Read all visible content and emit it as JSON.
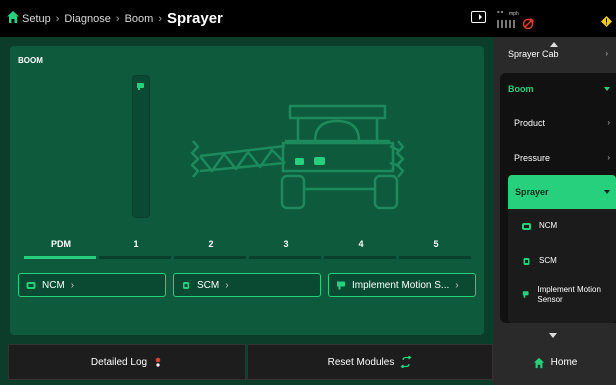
{
  "header": {
    "breadcrumbs": [
      "Setup",
      "Diagnose",
      "Boom"
    ],
    "title": "Sprayer",
    "speed": "--",
    "speed_unit": "mph"
  },
  "main": {
    "section_title": "BOOM",
    "tabs": [
      {
        "label": "PDM",
        "active": true
      },
      {
        "label": "1",
        "active": false
      },
      {
        "label": "2",
        "active": false
      },
      {
        "label": "3",
        "active": false
      },
      {
        "label": "4",
        "active": false
      },
      {
        "label": "5",
        "active": false
      }
    ],
    "modules": [
      {
        "label": "NCM",
        "icon": "ncm-module-icon"
      },
      {
        "label": "SCM",
        "icon": "scm-module-icon"
      },
      {
        "label": "Implement Motion S...",
        "icon": "motion-sensor-icon"
      }
    ]
  },
  "footer": {
    "detailed_log": "Detailed Log",
    "reset_modules": "Reset Modules"
  },
  "sidebar": {
    "cab": "Sprayer Cab",
    "boom": "Boom",
    "product": "Product",
    "pressure": "Pressure",
    "sprayer": "Sprayer",
    "leaves": [
      {
        "label": "NCM"
      },
      {
        "label": "SCM"
      },
      {
        "label": "Implement Motion Sensor"
      }
    ],
    "home": "Home"
  },
  "colors": {
    "accent": "#26d07c",
    "panel": "#0e5a3d",
    "background": "#0b3d2a"
  }
}
